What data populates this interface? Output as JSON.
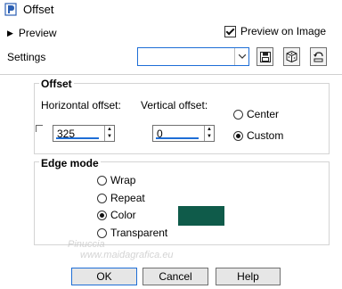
{
  "window": {
    "title": "Offset"
  },
  "preview": {
    "label": "Preview"
  },
  "preview_on_image": {
    "label": "Preview on Image",
    "checked": true
  },
  "settings": {
    "label": "Settings",
    "value": ""
  },
  "offset_group": {
    "label": "Offset",
    "horizontal": {
      "label": "Horizontal offset:",
      "value": "325"
    },
    "vertical": {
      "label": "Vertical offset:",
      "value": "0"
    },
    "center_label": "Center",
    "custom_label": "Custom",
    "selected": "Custom"
  },
  "edge_group": {
    "label": "Edge mode",
    "options": [
      "Wrap",
      "Repeat",
      "Color",
      "Transparent"
    ],
    "selected": "Color",
    "color": "#0f5b4a"
  },
  "buttons": {
    "ok": "OK",
    "cancel": "Cancel",
    "help": "Help"
  },
  "watermark": {
    "name": "Pinuccia",
    "site": "www.maidagrafica.eu"
  }
}
